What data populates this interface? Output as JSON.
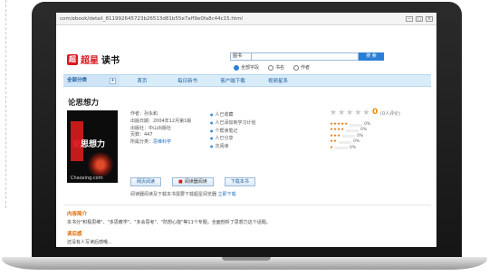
{
  "browser": {
    "url": "com/ebook/detail_811992645723b26513d81b55e7aff9e0fa8c44c15.html",
    "controls": [
      "−",
      "□",
      "×"
    ]
  },
  "site": {
    "logo_mark": "超",
    "logo_text": "超星",
    "logo_sub": "读书",
    "search_category": "图书",
    "search_button": "搜 索",
    "search_options": [
      "全部字段",
      "书名",
      "作者"
    ]
  },
  "nav": {
    "all_categories": "全部分类",
    "toggle": "+",
    "items": [
      "首页",
      "每日新书",
      "客户端下载",
      "视频星系"
    ]
  },
  "book": {
    "title": "论思想力",
    "cover_title_part1": "论",
    "cover_title_part2": "思想力",
    "cover_brand": "Chaoxing.com",
    "meta": {
      "author": "作者：孙永和",
      "publish_date": "出版日期：2004年12月第1版",
      "publisher": "出版社：中山出版社",
      "pages": "页数：447",
      "category_label": "所属分类：",
      "category_link": "思维科学"
    },
    "stats": [
      "人已收藏",
      "人已添加到学习计划",
      "个帮读笔记",
      "人已分享",
      "次阅读"
    ],
    "score": "0",
    "score_note": "(0人评价)",
    "rating_distribution": [
      {
        "stars": "★★★★★",
        "pct": "0%"
      },
      {
        "stars": "★★★★",
        "pct": "0%"
      },
      {
        "stars": "★★★",
        "pct": "0%"
      },
      {
        "stars": "★★",
        "pct": "0%"
      },
      {
        "stars": "★",
        "pct": "0%"
      }
    ]
  },
  "actions": {
    "read_online": "网页阅读",
    "reader_read": "阅读器阅读",
    "download": "下载本书"
  },
  "notice": {
    "text": "阅读器阅读及下载本书需要下载超星阅览器 ",
    "link": "立即下载"
  },
  "sections": {
    "intro_title": "内容简介",
    "intro_text": "本书分\"积极思维\"、\"多思教学\"、\"多会思考\"、\"防想心能\"等11个专题，全面剖析了思想力这个话题。",
    "review_title": "读后感",
    "review_text": "还没有人写读后感哦..."
  }
}
